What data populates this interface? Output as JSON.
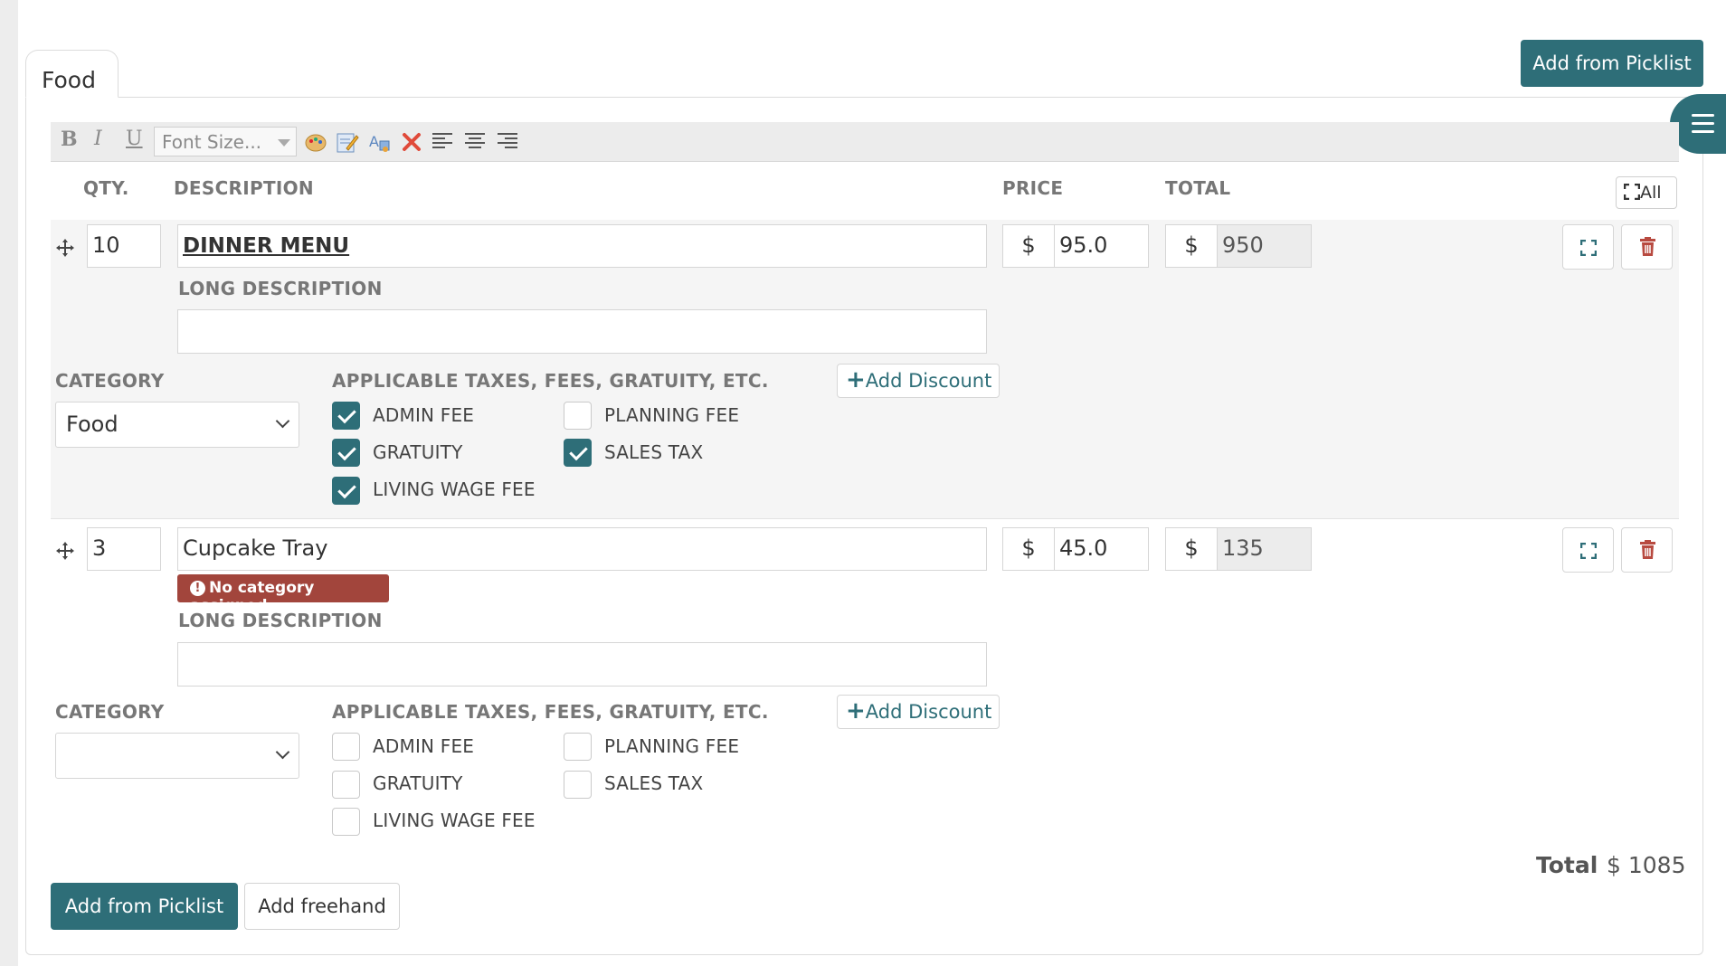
{
  "tab": {
    "label": "Food"
  },
  "header": {
    "add_from_picklist": "Add from Picklist"
  },
  "toolbar": {
    "bold": "B",
    "italic": "I",
    "underline": "U",
    "font_size_placeholder": "Font Size..."
  },
  "columns": {
    "qty": "QTY.",
    "description": "DESCRIPTION",
    "price": "PRICE",
    "total": "TOTAL",
    "all": "All"
  },
  "labels": {
    "long_description": "LONG DESCRIPTION",
    "category": "CATEGORY",
    "taxes": "APPLICABLE TAXES, FEES, GRATUITY, ETC.",
    "add_discount": "Add Discount",
    "currency": "$"
  },
  "items": [
    {
      "qty": "10",
      "description": "DINNER MENU",
      "price": "95.0",
      "total": "950",
      "long_description": "",
      "category": "Food",
      "warning": "",
      "fees": [
        {
          "label": "ADMIN FEE",
          "checked": true
        },
        {
          "label": "PLANNING FEE",
          "checked": false
        },
        {
          "label": "GRATUITY",
          "checked": true
        },
        {
          "label": "SALES TAX",
          "checked": true
        },
        {
          "label": "LIVING WAGE FEE",
          "checked": true
        }
      ]
    },
    {
      "qty": "3",
      "description": "Cupcake Tray",
      "price": "45.0",
      "total": "135",
      "long_description": "",
      "category": "",
      "warning": "No category assigned",
      "fees": [
        {
          "label": "ADMIN FEE",
          "checked": false
        },
        {
          "label": "PLANNING FEE",
          "checked": false
        },
        {
          "label": "GRATUITY",
          "checked": false
        },
        {
          "label": "SALES TAX",
          "checked": false
        },
        {
          "label": "LIVING WAGE FEE",
          "checked": false
        }
      ]
    }
  ],
  "summary": {
    "total_label": "Total",
    "total_value": "$ 1085"
  },
  "footer": {
    "add_from_picklist": "Add from Picklist",
    "add_freehand": "Add freehand"
  },
  "colors": {
    "primary": "#2e6e78",
    "danger": "#a2453c",
    "delete_icon": "#b84a40"
  }
}
